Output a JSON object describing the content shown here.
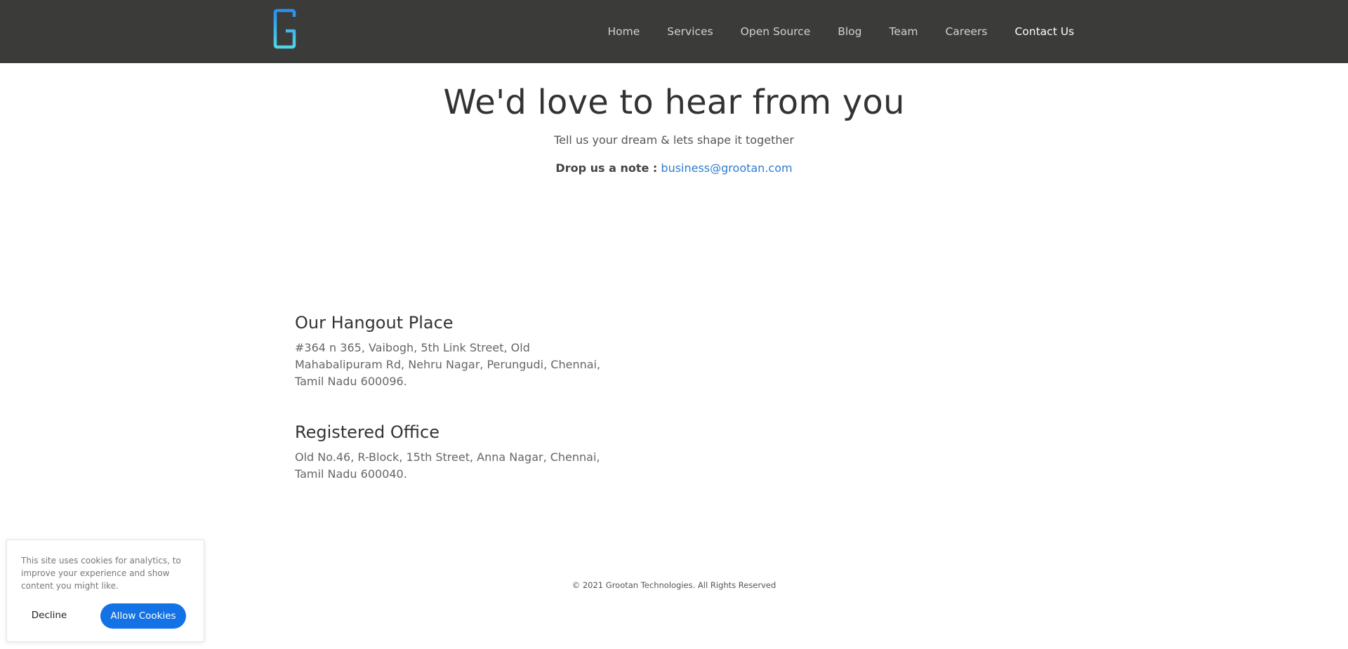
{
  "header": {
    "logo_icon": "grootan-g-logo-icon",
    "logo_colors": [
      "#2a8ff0",
      "#4ed6e6"
    ],
    "nav": [
      {
        "label": "Home",
        "active": false
      },
      {
        "label": "Services",
        "active": false
      },
      {
        "label": "Open Source",
        "active": false
      },
      {
        "label": "Blog",
        "active": false
      },
      {
        "label": "Team",
        "active": false
      },
      {
        "label": "Careers",
        "active": false
      },
      {
        "label": "Contact Us",
        "active": true
      }
    ]
  },
  "hero": {
    "title": "We'd love to hear from you",
    "subtitle": "Tell us your dream & lets shape it together",
    "note_label": "Drop us a note :",
    "email": "business@grootan.com"
  },
  "addresses": {
    "hangout": {
      "heading": "Our Hangout Place",
      "text": "#364 n 365, Vaibogh, 5th Link Street, Old Mahabalipuram Rd, Nehru Nagar, Perungudi, Chennai, Tamil Nadu 600096."
    },
    "registered": {
      "heading": "Registered Office",
      "text": "Old No.46, R-Block, 15th Street, Anna Nagar, Chennai, Tamil Nadu 600040."
    }
  },
  "footer": {
    "copyright": "© 2021 Grootan Technologies. All Rights Reserved"
  },
  "cookie_banner": {
    "text": "This site uses cookies for analytics, to improve your experience and show content you might like.",
    "decline_label": "Decline",
    "allow_label": "Allow Cookies"
  },
  "colors": {
    "navbar_bg": "#3b3b3a",
    "link": "#2e7bd1",
    "accent_button": "#1373e6"
  }
}
